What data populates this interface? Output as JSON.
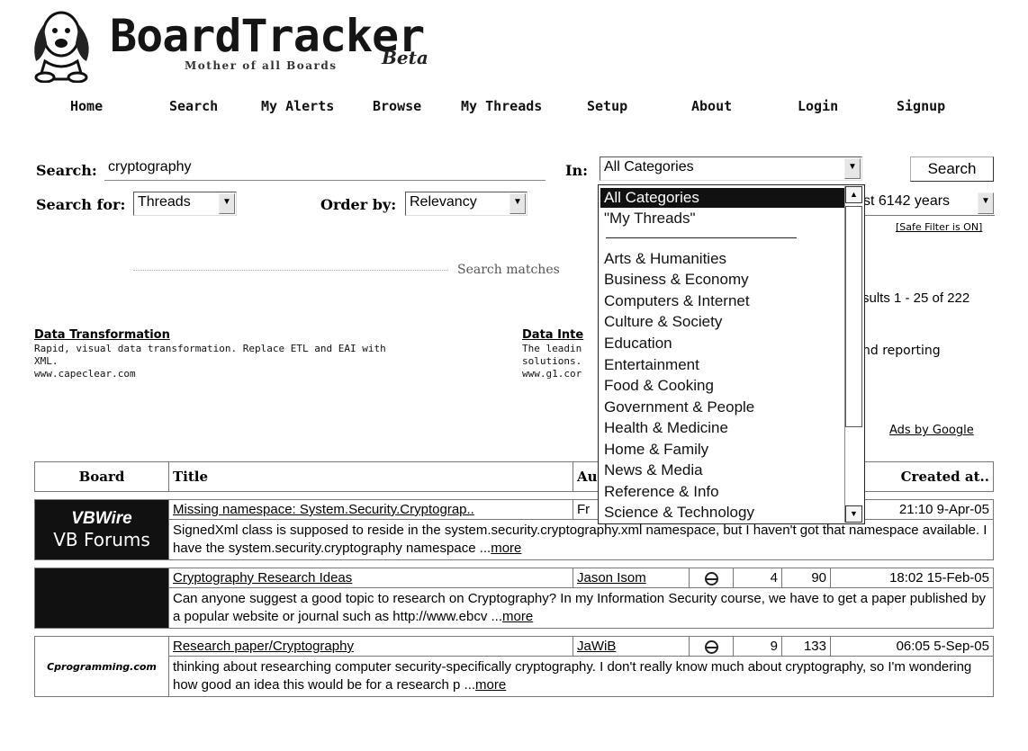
{
  "logo": {
    "word": "BoardTracker",
    "tagline": "Mother of all Boards",
    "beta": "Beta"
  },
  "nav": [
    "Home",
    "Search",
    "My Alerts",
    "Browse",
    "My Threads",
    "Setup",
    "About",
    "Login",
    "Signup"
  ],
  "search": {
    "label": "Search:",
    "query": "cryptography",
    "in_label": "In:",
    "in_value": "All Categories",
    "button": "Search",
    "for_label": "Search for:",
    "for_value": "Threads",
    "order_label": "Order by:",
    "order_value": "Relevancy",
    "time_value": "st 6142 years",
    "safe_filter": "[Safe Filter is ON]"
  },
  "categories": [
    "All Categories",
    "\"My Threads\"",
    "Arts & Humanities",
    "Business & Economy",
    "Computers & Internet",
    "Culture & Society",
    "Education",
    "Entertainment",
    "Food & Cooking",
    "Government & People",
    "Health & Medicine",
    "Home & Family",
    "News & Media",
    "Reference & Info",
    "Science & Technology"
  ],
  "status": {
    "matches": "Search matches",
    "results": "sults 1 - 25 of 222"
  },
  "ads": {
    "left": {
      "title": "Data Transformation",
      "text1": "Rapid, visual data transformation. Replace ETL and EAI with",
      "text2": "XML.",
      "url": "www.capeclear.com"
    },
    "right": {
      "title": "Data Inte",
      "text1": "The leadin",
      "text2": "solutions.",
      "url": "www.g1.cor"
    },
    "right_tail": "nd reporting",
    "by_google": "Ads by Google"
  },
  "table": {
    "headers": {
      "board": "Board",
      "title": "Title",
      "author": "Au",
      "created": "Created at.."
    },
    "rows": [
      {
        "board_line1": "VBWire",
        "board_line2": "VB Forums",
        "title": "Missing namespace: System.Security.Cryptograp..",
        "author": "Fr",
        "replies": "",
        "views": "",
        "created": "21:10 9-Apr-05",
        "snippet": "SignedXml class is supposed to reside in the system.security.cryptography.xml namespace, but I haven't got that namespace available. I have the system.security.cryptography namespace ...",
        "more": "more"
      },
      {
        "board_line1": "",
        "board_line2": "",
        "title": "Cryptography Research Ideas",
        "author": "Jason Isom",
        "replies": "4",
        "views": "90",
        "created": "18:02 15-Feb-05",
        "snippet": "Can anyone suggest a good topic to research on Cryptography? In my Information Security course, we have to get a paper published by a popular website or journal such as http://www.ebcv ...",
        "more": "more"
      },
      {
        "board_line1": "Cprogramming.com",
        "board_line2": "",
        "title": "Research paper/Cryptography",
        "author": "JaWiB",
        "replies": "9",
        "views": "133",
        "created": "06:05 5-Sep-05",
        "snippet": "thinking about researching computer security-specifically cryptography. I don't really know much about cryptography, so I'm wondering how good an idea this would be for a research p ...",
        "more": "more"
      }
    ]
  }
}
